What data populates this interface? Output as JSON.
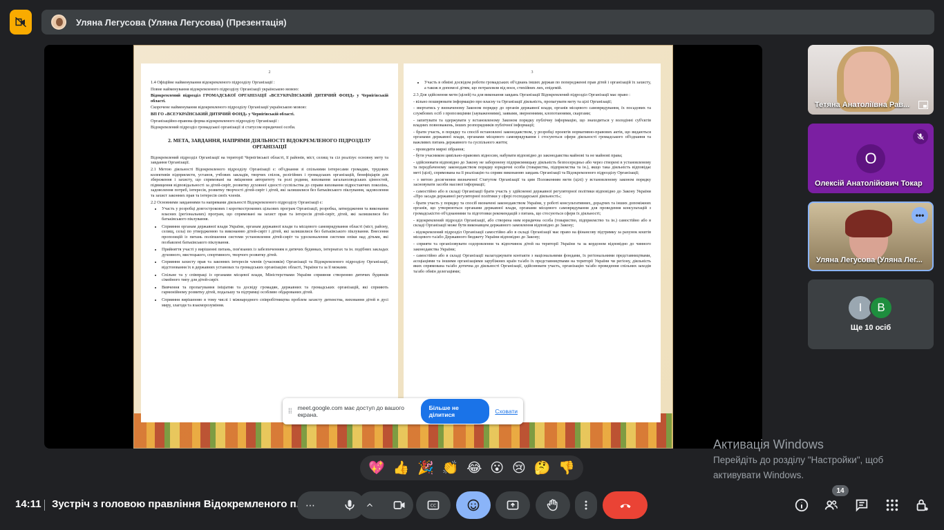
{
  "presenter": {
    "title": "Уляна Легусова (Уляна Легусова) (Презентація)"
  },
  "slide": {
    "left_page_number": "2",
    "right_page_number": "3",
    "left_section1_title": "1.4 Офіційне найменування відокремленого підрозділу Організації :",
    "left_p1": "Повне найменування відокремленого підрозділу Організації українською мовою:",
    "left_p1_bold": "Відокремлений підрозділ ГРОМАДСЬКОЇ ОРГАНІЗАЦІЇ «ВСЕУКРАЇНСЬКИЙ ДИТЯЧИЙ ФОНД» у Чернігівській області.",
    "left_p2": "Скорочене найменування відокремленого підрозділу Організації українською мовою:",
    "left_p2_bold": "ВП ГО «ВСЕУКРАЇНСЬКИЙ ДИТЯЧИЙ ФОНД» у Чернігівській області.",
    "left_p3": "Організаційно-правова форма відокремленого підрозділу Організації :",
    "left_p4": "Відокремлений підрозділ громадської організації зі статусом юридичної особи.",
    "left_heading": "2. МЕТА, ЗАВДАННЯ, НАПРЯМИ ДІЯЛЬНОСТІ ВІДОКРЕМЛЕНОГО ПІДРОЗДІЛУ ОРГАНІЗАЦІЇ",
    "left_p5": "Відокремлений підрозділ Організації на території Чернігівської області, її районів, міст, селищ та сіл реалізує основну мету та завдання Організації.",
    "left_p6": "2.1 Метою діяльності Відокремленого підрозділу Організації є: об'єднання зі спільними інтересами громадян, трудових колективів підприємств, установ, учбових закладів, творчих спілок, релігійних і громадських організацій, бенефіціарів для збереження і захисту, що спрямовані на зміцнення авторитету та ролі родини, виховання загальнолюдських цінностей, підвищення відповідальності за дітей-сиріт, розвитку духовної єдності суспільства до справи виховання підростаючих поколінь, задоволення потреб, інтересів, розвитку творчості дітей-сиріт і дітей, які залишилися без батьківського піклування, задоволення та захист законних прав та інтересів своїх членів.",
    "left_p7": "2.2 Основними завданнями та напрямами діяльності Відокремленого підрозділу Організації є:",
    "left_list": [
      "Участь у розробці довгострокових і короткострокових цільових програм Організації, розробка, затвердження та виконання власних (регіональних) програм, що спрямовані на захист прав та інтересів дітей-сиріт, дітей, які залишилися без батьківського піклування.",
      "Сприяння органам державної влади України, органам державної влади та місцевого самоврядування області (міст, району, селищ, села) по утвердженню та виконанню дітей-сиріт і дітей, які залишилися без батьківського піклування. Внесення пропозицій із питань поліпшення системи установлення дітей-сиріт та удосконалення системи опіки над дітьми, які позбавлені батьківського піклування.",
      "Прийняття участі у вирішенні питань, пов'язаних із забезпеченням в дитячих будинках, інтернатах та ін. подібних закладах духовного, мистецького, спортивного, творчого розвитку дітей.",
      "Сприяння захисту прав та законних інтересів членів (учасників) Організації та Відокремленого підрозділу Організації, відстоювання їх в державних установах та громадських організаціях області, України та за її межами.",
      "Спільне та у співпраці із органами місцевої влади, Міністерствами України сприяння створенню дитячих будинків сімейного типу для дітей-сиріт.",
      "Вивчення та пропагування ініціатив та досвіду громадян, державних та громадських організацій, які сприяють гармонійному розвитку дітей, подальшу та підтримці особливо обдарованих дітей.",
      "Сприяння вирішенню в тому числі і міжнародного співробітництва проблем захисту дитинства, виховання дітей в дусі миру, злагоди та взаєморозуміння."
    ],
    "right_bullet": "Участь в обміні досвідом роботи громадських об'єднань інших держав по попередженні прав дітей і організацій їх захисту, а також в допомозі дітям, що потрапляли від воєн, стихійних лих, епідемій.",
    "right_p1": "2.3 Для здійснення мети (цілей) та для виконання завдань Організації Відокремлений підрозділ Організації має право :",
    "right_items": [
      "- вільно поширювати інформацію про власну та Організації діяльність, пропагувати мету та цілі Організації;",
      "- звертатись у визначеному Законом порядку до органів державної влади, органів місцевого самоврядування, їх посадових та службових осіб з пропозиціями (зауваженнями), заявами, зверненнями, клопотаннями, скаргами;",
      "- запитувати та одержувати у встановленому Законом порядку публічну інформацію, що знаходиться у володінні суб'єктів владних повноважень, інших розпорядників публічної інформації;",
      "- брати участь, в порядку та спосіб встановлені законодавством, у розробці проектів нормативно-правових актів, що видаються органами державної влади, органами місцевого самоврядування і стосуються сфери діяльності громадського об'єднання та важливих питань державного та суспільного життя;",
      "- проводити мирні зібрання;",
      "- бути учасником цивільно-правових відносин, набувати відповідно до законодавства майнові та не майнові права;",
      "- здійснювати відповідно до Закону не заборонену підприємницьку діяльність безпосередньо або через створені в установленому та передбаченому законодавством порядку юридичні особи (товариства, підприємства та ін.), якщо така діяльність відповідає меті (цілі), спрямована на її реалізацію та сприяє виконанню завдань Організації та Відокремленого підрозділу Організації;",
      "- з метою досягнення визначеної Статутом Організації та цим Положенням мети (цілі) у встановленому законом порядку засновувати засоби масової інформації;",
      "- самостійно або в складі Організації брати участь у здійсненні державної регуляторної політики відповідно до Закону України «Про засади державної регуляторної політики у сфері господарської діяльності»;",
      "- брати участь у порядку та спосіб визначені законодавством України, у роботі консультативних, дорадчих та інших допоміжних органів, що утворюються органами державної влади, органами місцевого самоврядування для проведення консультацій з громадськістю об'єднаннями та підготовки рекомендацій з питань, що стосуються сфери їх діяльності;",
      "- відокремлений підрозділ Організації, або створена ним юридична особа (товариство, підприємство та ін.) самостійно або в складі Організації може бути виконавцем державного замовлення відповідно до Закону;",
      "- відокремлений підрозділ Організації самостійно або в складі Організації має право на фінансову підтримку за рахунок коштів місцевого та/або Державного бюджету України відповідно до Закону;",
      "- сприяти та організовувати оздоровлення та відпочинок дітей на території України та за кордоном відповідно до чинного законодавства України;",
      "- самостійно або в складі Організації налагоджувати контакти з національними фондами, їх регіональними представництвами, асоціаціями та іншими організаціями зарубіжних країн та/або їх представництвами на території України чи регіону, діяльність яких спрямована та/або дотична до діяльності Організації, здійснювати участь, організацію та/або проведення спільних заходів та/або обмін делегаціями;"
    ]
  },
  "share_toast": {
    "text": "meet.google.com має доступ до вашого екрана.",
    "stop_label": "Більше не ділитися",
    "hide_label": "Сховати"
  },
  "participants": [
    {
      "name": "Тетяна Анатоліївна Рав..."
    },
    {
      "name": "Олексій Анатолійович Токар",
      "initial": "О"
    },
    {
      "name": "Уляна Легусова (Уляна Лег..."
    }
  ],
  "others": {
    "initials": [
      "І",
      "В"
    ],
    "label": "Ще 10 осіб"
  },
  "activation": {
    "title": "Активація Windows",
    "line1": "Перейдіть до розділу \"Настройки\", щоб",
    "line2": "активувати Windows."
  },
  "reactions": [
    "💖",
    "👍",
    "🎉",
    "👏",
    "😂",
    "😮",
    "😢",
    "🤔",
    "👎"
  ],
  "bottom": {
    "time": "14:11",
    "meeting_title": "Зустріч з головою правління Відокремленого п...",
    "people_count": "14"
  },
  "colors": {
    "end_call": "#ea4335",
    "active_control": "#8ab4f8",
    "cam_off_badge": "#f9ab00",
    "stop_share": "#1a73e8"
  }
}
